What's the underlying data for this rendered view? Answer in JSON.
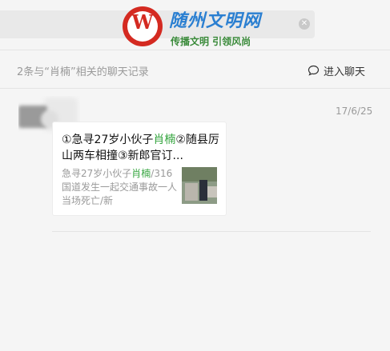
{
  "search": {
    "clear_icon": "✕"
  },
  "logo": {
    "mark": "W",
    "title": "随州文明网",
    "slogan": "传播文明  引领风尚"
  },
  "header": {
    "summary": "2条与“肖楠”相关的聊天记录",
    "enter_chat": "进入聊天",
    "chat_icon": "chat-bubble-icon"
  },
  "message": {
    "date": "17/6/25",
    "card": {
      "title_parts": [
        "①急寻27岁小伙子",
        "肖楠",
        "②随县厉山两车相撞③新郎官订..."
      ],
      "desc_parts": [
        "急寻27岁小伙子",
        "肖楠",
        "/316国道发生一起交通事故一人当场死亡/新"
      ]
    }
  },
  "colors": {
    "highlight": "#35a53f",
    "logo_red": "#d42a21",
    "logo_blue": "#2a7fd1",
    "logo_green": "#3a8a3a"
  }
}
